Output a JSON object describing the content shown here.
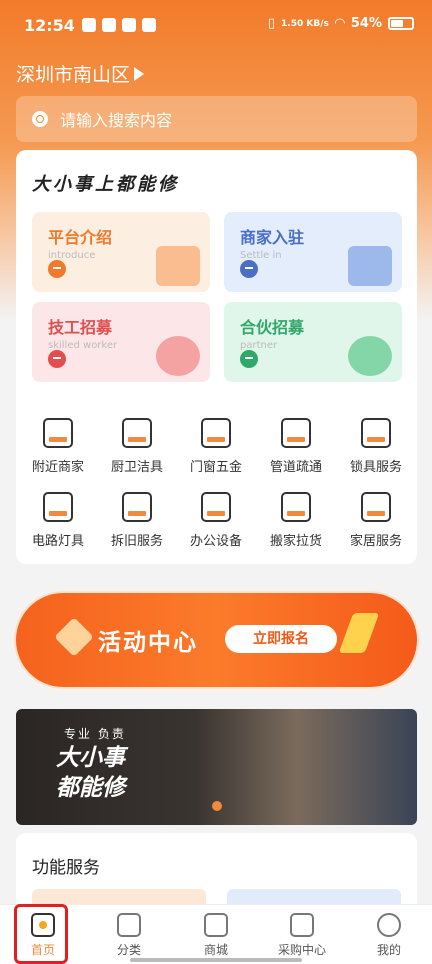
{
  "status": {
    "time": "12:54",
    "speed": "1.50 KB/s",
    "battery": "54%"
  },
  "location": "深圳市南山区",
  "search": {
    "placeholder": "请输入搜索内容"
  },
  "slogan": "大小事上都能修",
  "tiles": [
    {
      "title": "平台介绍",
      "subtitle": "introduce",
      "color": "#f07a2a",
      "bg": "#fdeee2",
      "arrow": "#f07a2a",
      "art": "#f6a86c"
    },
    {
      "title": "商家入驻",
      "subtitle": "Settle in",
      "color": "#4a6fc7",
      "bg": "#e4edfb",
      "arrow": "#4a6fc7",
      "art": "#7fa3e6"
    },
    {
      "title": "技工招募",
      "subtitle": "skilled worker",
      "color": "#e24e4e",
      "bg": "#fde6e8",
      "arrow": "#e24e4e",
      "art": "#f08585"
    },
    {
      "title": "合伙招募",
      "subtitle": "partner",
      "color": "#2fa86a",
      "bg": "#e1f6ea",
      "arrow": "#2fa86a",
      "art": "#5cc98c"
    }
  ],
  "services": [
    {
      "label": "附近商家",
      "icon": "store-icon"
    },
    {
      "label": "厨卫洁具",
      "icon": "kettle-icon"
    },
    {
      "label": "门窗五金",
      "icon": "door-icon"
    },
    {
      "label": "管道疏通",
      "icon": "faucet-icon"
    },
    {
      "label": "锁具服务",
      "icon": "lock-icon"
    },
    {
      "label": "电路灯具",
      "icon": "lamp-icon"
    },
    {
      "label": "拆旧服务",
      "icon": "hammer-icon"
    },
    {
      "label": "办公设备",
      "icon": "printer-icon"
    },
    {
      "label": "搬家拉货",
      "icon": "truck-icon"
    },
    {
      "label": "家居服务",
      "icon": "cabinet-icon"
    }
  ],
  "activity": {
    "title": "活动中心",
    "button": "立即报名"
  },
  "banner": {
    "subtitle": "专业 负责",
    "headline_1": "大小事",
    "headline_2": "都能修"
  },
  "function_section": {
    "title": "功能服务"
  },
  "tabs": [
    {
      "label": "首页",
      "icon": "home-icon",
      "active": true
    },
    {
      "label": "分类",
      "icon": "category-icon",
      "active": false
    },
    {
      "label": "商城",
      "icon": "shop-icon",
      "active": false
    },
    {
      "label": "采购中心",
      "icon": "purchase-icon",
      "active": false
    },
    {
      "label": "我的",
      "icon": "profile-icon",
      "active": false
    }
  ],
  "colors": {
    "accent": "#f08a3e",
    "highlight": "#e02020"
  }
}
